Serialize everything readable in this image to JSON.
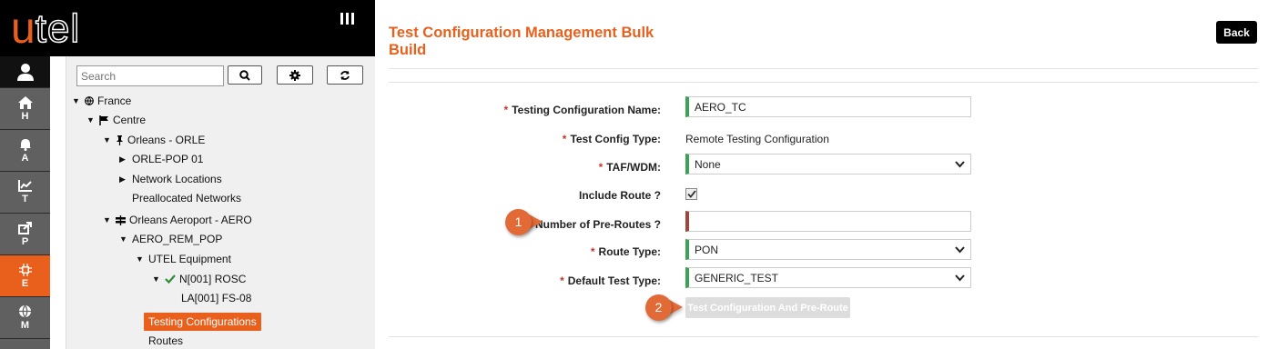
{
  "brand": {
    "logo_u": "u",
    "logo_rest": "tel",
    "accent": "#e8601c"
  },
  "rail": {
    "items": [
      {
        "letter": "H",
        "icon": "home-icon"
      },
      {
        "letter": "A",
        "icon": "bell-icon"
      },
      {
        "letter": "T",
        "icon": "chart-icon"
      },
      {
        "letter": "P",
        "icon": "share-icon"
      },
      {
        "letter": "E",
        "icon": "chip-icon",
        "active": true
      },
      {
        "letter": "M",
        "icon": "globe-icon"
      }
    ]
  },
  "tree": {
    "search_placeholder": "Search",
    "nodes": [
      {
        "label": "France",
        "icon": "globe-icon",
        "expanded": true
      },
      {
        "label": "Centre",
        "icon": "flag-icon",
        "expanded": true
      },
      {
        "label": "Orleans - ORLE",
        "icon": "pin-icon",
        "expanded": true
      },
      {
        "label": "ORLE-POP 01",
        "collapsed": true
      },
      {
        "label": "Network Locations",
        "collapsed": true
      },
      {
        "label": "Preallocated Networks"
      },
      {
        "label": "Orleans Aeroport - AERO",
        "icon": "signpost-icon",
        "expanded": true
      },
      {
        "label": "AERO_REM_POP",
        "expanded": true
      },
      {
        "label": "UTEL Equipment",
        "expanded": true
      },
      {
        "label": "N[001] ROSC",
        "icon": "check-icon",
        "expanded": true
      },
      {
        "label": "LA[001] FS-08"
      },
      {
        "label": "Testing Configurations",
        "selected": true
      },
      {
        "label": "Routes"
      }
    ]
  },
  "page": {
    "title": "Test Configuration Management Bulk Build",
    "back_label": "Back"
  },
  "form": {
    "required_mark": "*",
    "testing_config_name": {
      "label": "Testing Configuration Name:",
      "value": "AERO_TC"
    },
    "test_config_type": {
      "label": "Test Config Type:",
      "value": "Remote Testing Configuration"
    },
    "taf_wdm": {
      "label": "TAF/WDM:",
      "value": "None"
    },
    "include_route": {
      "label": "Include Route ?",
      "checked": true
    },
    "num_pre_routes": {
      "label": "Number of Pre-Routes ?",
      "value": ""
    },
    "route_type": {
      "label": "Route Type:",
      "value": "PON"
    },
    "default_test_type": {
      "label": "Default Test Type:",
      "value": "GENERIC_TEST"
    },
    "submit_label": "Test Configuration And Pre-Route"
  },
  "callouts": {
    "one": "1",
    "two": "2"
  }
}
